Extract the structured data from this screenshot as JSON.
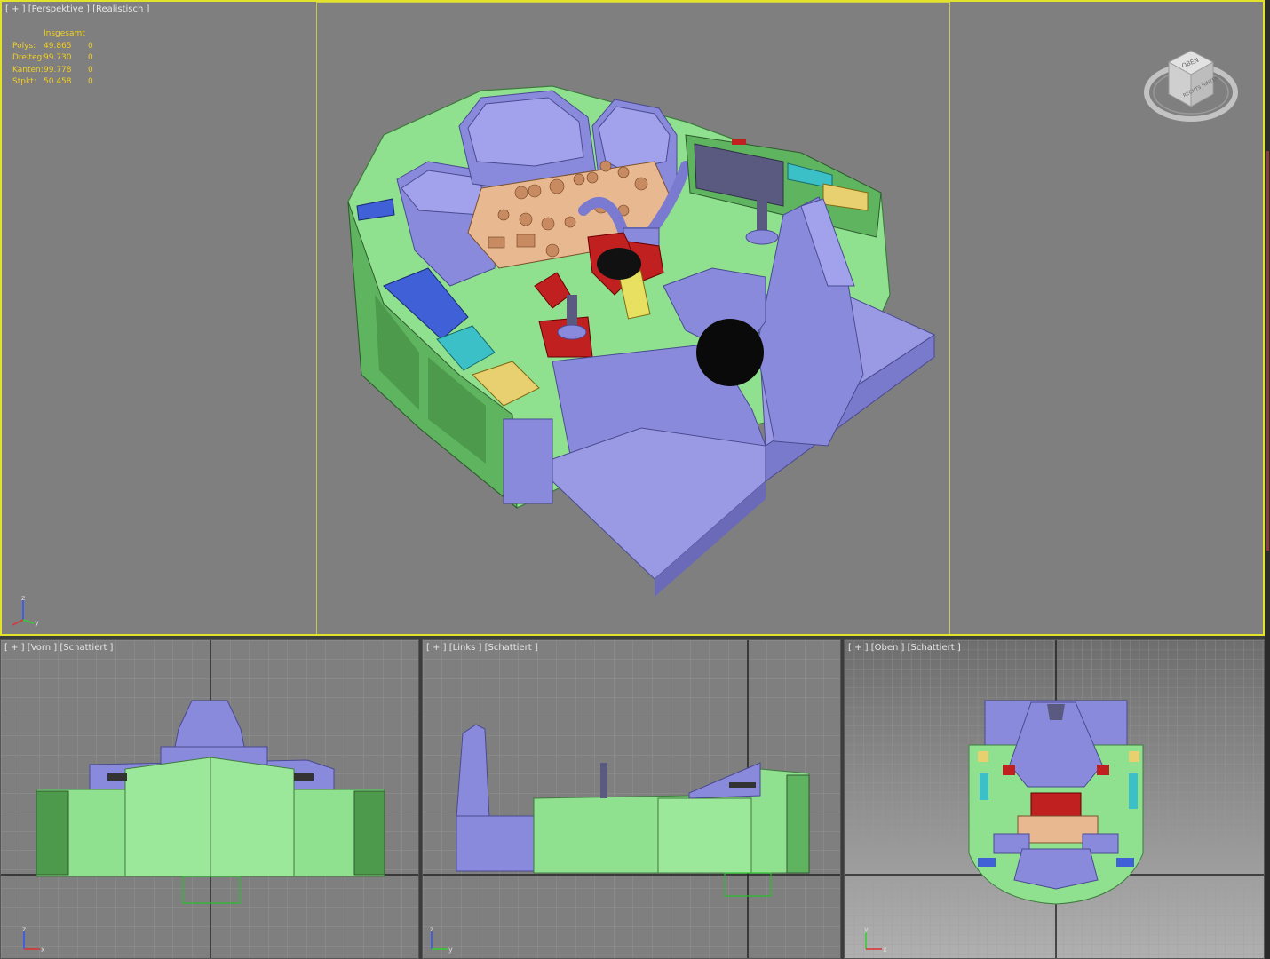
{
  "viewports": {
    "perspective": {
      "label_plus": "[ + ]",
      "label_view": "[Perspektive ]",
      "label_shading": "[Realistisch ]"
    },
    "front": {
      "label_plus": "[ + ]",
      "label_view": "[Vorn ]",
      "label_shading": "[Schattiert ]"
    },
    "left": {
      "label_plus": "[ + ]",
      "label_view": "[Links ]",
      "label_shading": "[Schattiert ]"
    },
    "top": {
      "label_plus": "[ + ]",
      "label_view": "[Oben ]",
      "label_shading": "[Schattiert ]"
    }
  },
  "stats": {
    "header": "Insgesamt",
    "rows": [
      {
        "label": "Polys:",
        "value": "49.865",
        "sel": "0"
      },
      {
        "label": "Dreiteg:",
        "value": "99.730",
        "sel": "0"
      },
      {
        "label": "Kanten:",
        "value": "99.778",
        "sel": "0"
      },
      {
        "label": "Stpkt:",
        "value": "50.458",
        "sel": "0"
      }
    ]
  },
  "viewcube": {
    "face_top": "OBEN",
    "face_front": "RECHTS HINTEN"
  },
  "axis": {
    "x": "x",
    "y": "y",
    "z": "z"
  },
  "colors": {
    "viewport_bg": "#7f7f7f",
    "active_border": "#e2e22a",
    "stats_text": "#f0d020",
    "mesh_green": "#8fe08f",
    "mesh_blue": "#8a8adc",
    "mesh_tan": "#e8b890",
    "mesh_red": "#c02020"
  }
}
